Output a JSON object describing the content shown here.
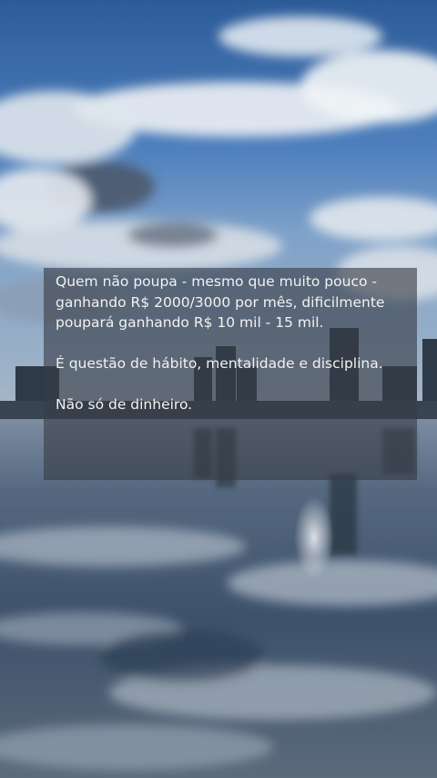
{
  "caption": {
    "paragraph_1": "Quem não poupa - mesmo que muito pouco - ganhando R$ 2000/3000 por mês, dificilmente poupará ganhando R$ 10 mil - 15 mil.",
    "paragraph_2": "É questão de hábito, mentalidade e disciplina.",
    "paragraph_3": "Não só de dinheiro."
  },
  "colors": {
    "sky_top": "#2f5f9c",
    "sky_mid": "#5f8fc8",
    "cloud": "#e7ecf2",
    "water": "#3f5570",
    "caption_bg": "#373c46",
    "caption_text": "#f2f2f2"
  }
}
